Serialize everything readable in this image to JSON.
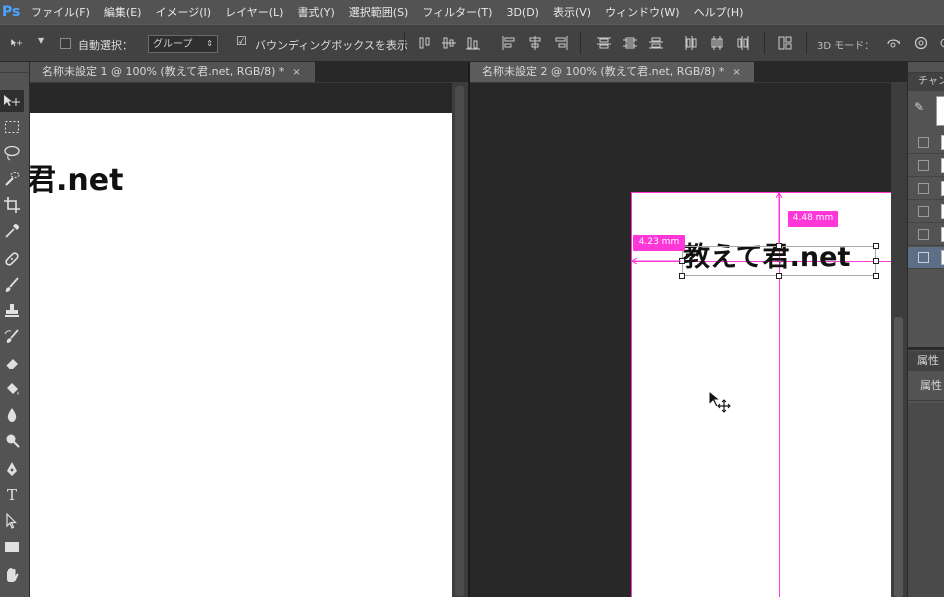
{
  "app": {
    "logo": "Ps"
  },
  "menu": [
    "ファイル(F)",
    "編集(E)",
    "イメージ(I)",
    "レイヤー(L)",
    "書式(Y)",
    "選択範囲(S)",
    "フィルター(T)",
    "3D(D)",
    "表示(V)",
    "ウィンドウ(W)",
    "ヘルプ(H)"
  ],
  "options": {
    "auto_select_label": "自動選択：",
    "auto_select_value": "グループ",
    "bounding_box_label": "バウンディングボックスを表示",
    "bounding_box_checked": true,
    "mode_3d_label": "3D モード："
  },
  "documents": [
    {
      "tab": "名称未設定 1 @ 100% (教えて君.net, RGB/8) *",
      "close": "×",
      "canvas_text": "君.net"
    },
    {
      "tab": "名称未設定 2 @ 100% (教えて君.net, RGB/8) *",
      "close": "×",
      "canvas_text": "教えて君.net"
    }
  ],
  "measures": {
    "vertical": "4.48 mm",
    "horizontal": "4.23 mm"
  },
  "panels": {
    "channels_tab": "チャン",
    "properties_tab": "属性",
    "properties_sub": "属性"
  },
  "colors": {
    "guide": "#ff36d8",
    "accent": "#4aa6ff"
  }
}
